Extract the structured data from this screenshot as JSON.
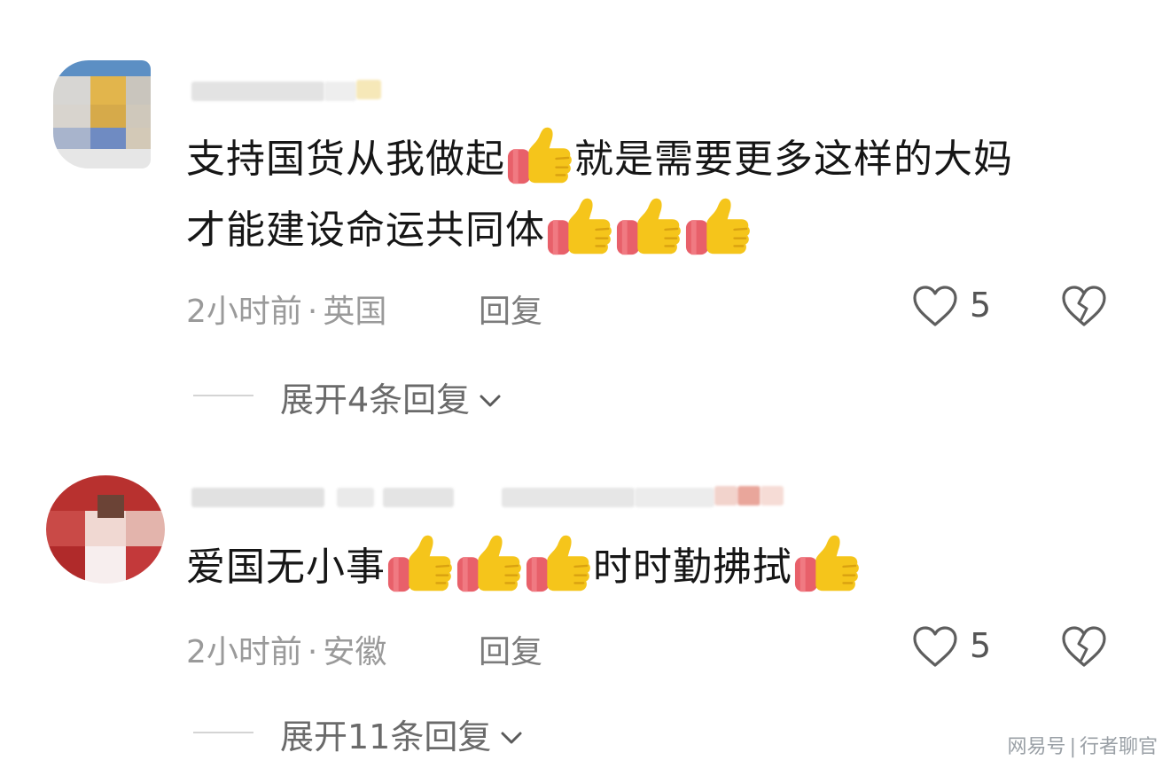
{
  "comments": [
    {
      "text_line1_a": "支持国货从我做起",
      "text_line1_b": "就是需要更多这样的大妈",
      "text_line2": "才能建设命运共同体",
      "time": "2小时前",
      "location": "英国",
      "reply_label": "回复",
      "likes": "5",
      "expand_label": "展开4条回复"
    },
    {
      "text_a": "爱国无小事",
      "text_b": "时时勤拂拭",
      "time": "2小时前",
      "location": "安徽",
      "reply_label": "回复",
      "likes": "5",
      "expand_label": "展开11条回复"
    }
  ],
  "meta_separator": "·",
  "watermark": {
    "platform": "网易号",
    "author": "行者聊官"
  },
  "icons": {
    "emoji": "thumbs-up-icon",
    "like": "heart-outline-icon",
    "dislike": "broken-heart-icon",
    "expand": "chevron-down-icon"
  },
  "colors": {
    "meta_text": "#9a9a9a",
    "body_text": "#161616",
    "thumb_yellow": "#f5c51b",
    "thumb_sleeve": "#e8606a"
  }
}
